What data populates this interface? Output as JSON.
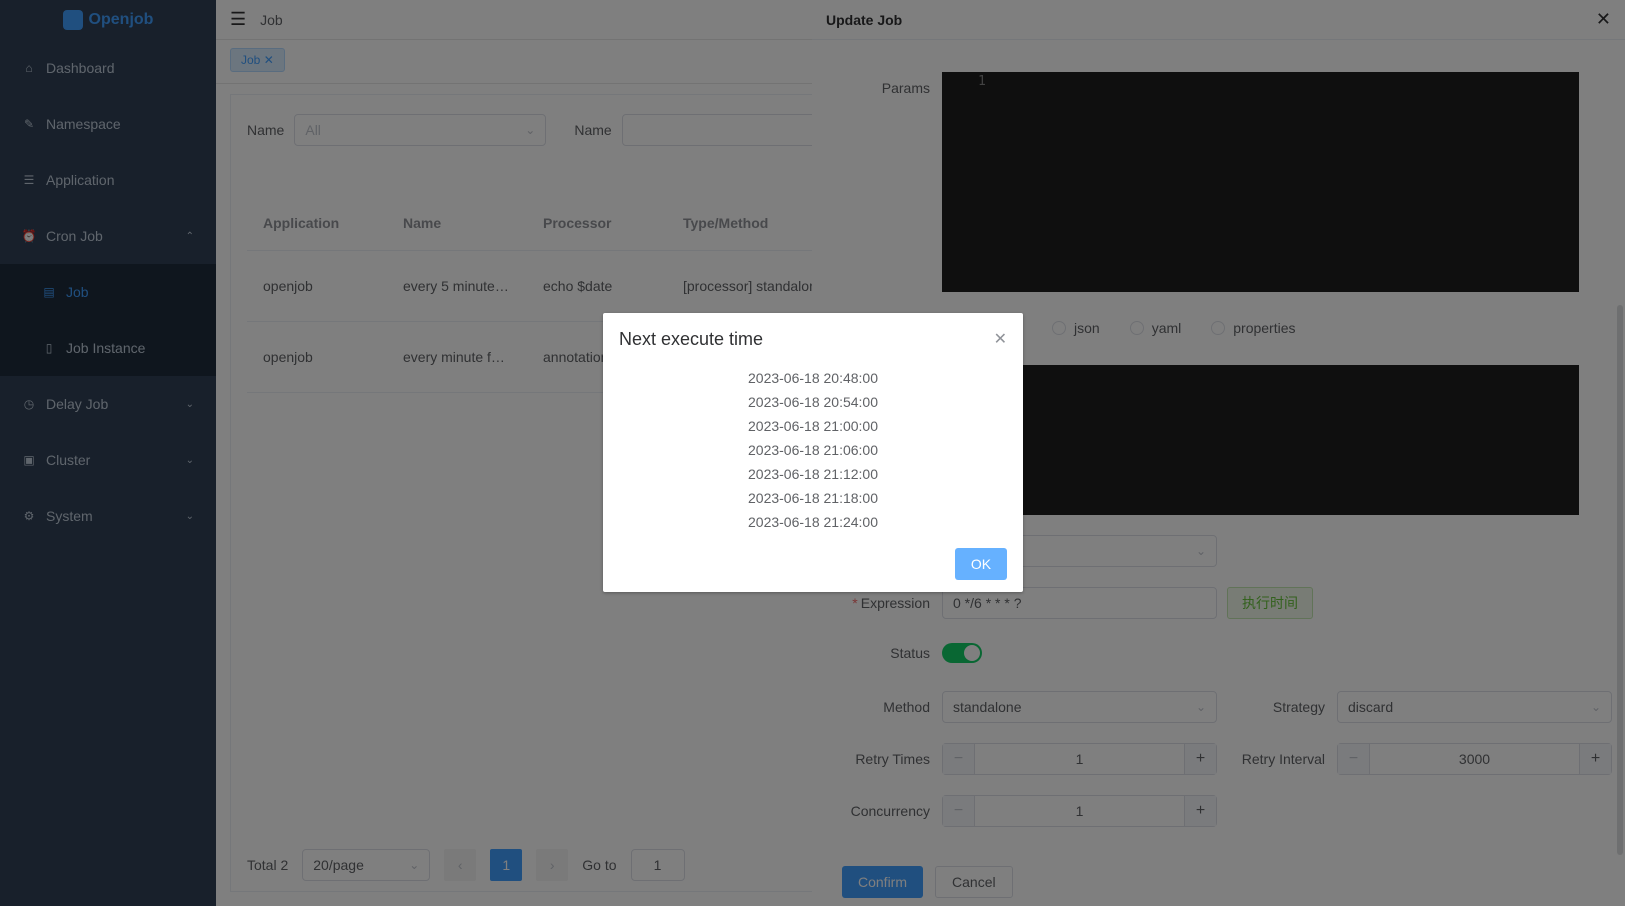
{
  "app": {
    "logo_text": "Openjob"
  },
  "sidebar": {
    "items": [
      {
        "label": "Dashboard",
        "icon": "home-icon"
      },
      {
        "label": "Namespace",
        "icon": "edit-icon"
      },
      {
        "label": "Application",
        "icon": "list-icon"
      },
      {
        "label": "Cron Job",
        "icon": "alarm-icon",
        "expanded": true
      },
      {
        "label": "Job",
        "icon": "calendar-icon",
        "active": true,
        "sub": true
      },
      {
        "label": "Job Instance",
        "icon": "document-icon",
        "sub": true
      },
      {
        "label": "Delay Job",
        "icon": "clock-icon"
      },
      {
        "label": "Cluster",
        "icon": "server-icon"
      },
      {
        "label": "System",
        "icon": "gear-icon"
      }
    ]
  },
  "navbar": {
    "breadcrumb": "Job"
  },
  "tags": {
    "active_tag": "Job"
  },
  "filter": {
    "app_label": "Name",
    "app_value": "All",
    "name_label": "Name"
  },
  "table": {
    "headers": [
      "Application",
      "Name",
      "Processor",
      "Type/Method"
    ],
    "rows": [
      [
        "openjob",
        "every 5 minute…",
        "echo $date",
        "[processor] standalone"
      ],
      [
        "openjob",
        "every minute f…",
        "annotation",
        ""
      ]
    ]
  },
  "pagination": {
    "total": "Total 2",
    "page_size": "20/page",
    "current_page": "1",
    "goto_label": "Go to",
    "goto_value": "1"
  },
  "drawer": {
    "title": "Update Job",
    "params_label": "Params",
    "params_line": "1",
    "param_types": [
      "json",
      "yaml",
      "properties"
    ],
    "expression_label": "Expression",
    "expression_value": "0 */6 * * * ?",
    "exec_time_button": "执行时间",
    "status_label": "Status",
    "status_on": true,
    "method_label": "Method",
    "method_value": "standalone",
    "strategy_label": "Strategy",
    "strategy_value": "discard",
    "retry_times_label": "Retry Times",
    "retry_times_value": "1",
    "retry_interval_label": "Retry Interval",
    "retry_interval_value": "3000",
    "concurrency_label": "Concurrency",
    "concurrency_value": "1",
    "confirm_label": "Confirm",
    "cancel_label": "Cancel"
  },
  "modal": {
    "title": "Next execute time",
    "times": [
      "2023-06-18 20:48:00",
      "2023-06-18 20:54:00",
      "2023-06-18 21:00:00",
      "2023-06-18 21:06:00",
      "2023-06-18 21:12:00",
      "2023-06-18 21:18:00",
      "2023-06-18 21:24:00"
    ],
    "ok_label": "OK"
  },
  "colors": {
    "sidebar_bg": "#304156",
    "primary": "#409eff",
    "success": "#13ce66"
  }
}
